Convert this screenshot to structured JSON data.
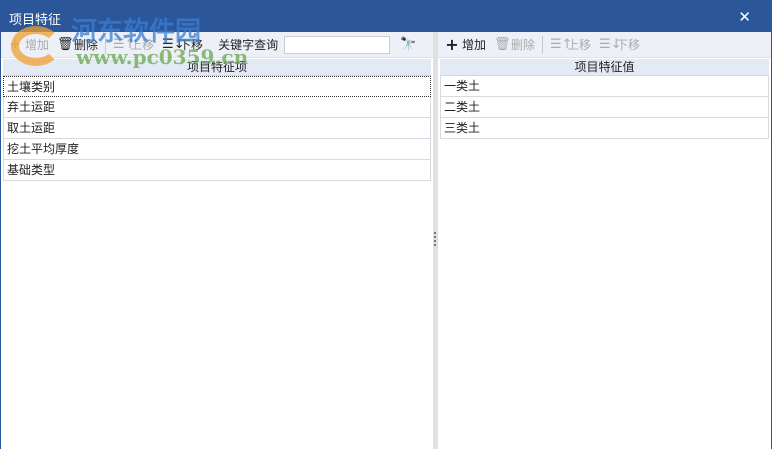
{
  "window": {
    "title": "项目特征",
    "close": "✕"
  },
  "watermark": {
    "name": "河东软件园",
    "url": "www.pc0359.cn"
  },
  "left": {
    "toolbar": {
      "add": "增加",
      "delete": "删除",
      "up": "上移",
      "down": "下移",
      "keyword_label": "关键字查询",
      "keyword_value": ""
    },
    "header": "项目特征项",
    "rows": [
      "土壤类别",
      "弃土运距",
      "取土运距",
      "挖土平均厚度",
      "基础类型"
    ]
  },
  "right": {
    "toolbar": {
      "add": "增加",
      "delete": "删除",
      "up": "上移",
      "down": "下移"
    },
    "header": "项目特征值",
    "rows": [
      "一类土",
      "二类土",
      "三类土"
    ]
  }
}
